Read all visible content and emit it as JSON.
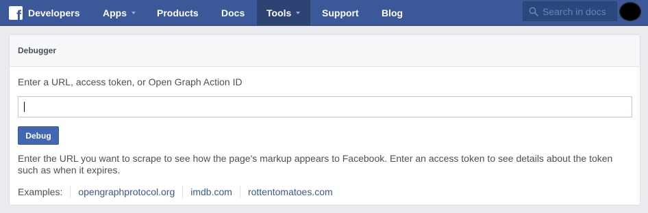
{
  "nav": {
    "brand_label": "Developers",
    "logo_glyph": "f",
    "items": [
      {
        "label": "Apps",
        "has_dropdown": true
      },
      {
        "label": "Products",
        "has_dropdown": false
      },
      {
        "label": "Docs",
        "has_dropdown": false
      },
      {
        "label": "Tools",
        "has_dropdown": true,
        "active": true
      },
      {
        "label": "Support",
        "has_dropdown": false
      },
      {
        "label": "Blog",
        "has_dropdown": false
      }
    ],
    "search_placeholder": "Search in docs",
    "search_icon": "magnifier-icon"
  },
  "debugger": {
    "title": "Debugger",
    "input_label": "Enter a URL, access token, or Open Graph Action ID",
    "input_value": "",
    "button_label": "Debug",
    "description": "Enter the URL you want to scrape to see how the page's markup appears to Facebook. Enter an access token to see details about the token such as when it expires.",
    "examples_label": "Examples:",
    "examples": [
      "opengraphprotocol.org",
      "imdb.com",
      "rottentomatoes.com"
    ]
  },
  "colors": {
    "brand_blue": "#3b5998",
    "active_nav": "#2d4373",
    "button_blue": "#4267b2",
    "link_blue": "#365899",
    "page_bg": "#e9ebee"
  }
}
